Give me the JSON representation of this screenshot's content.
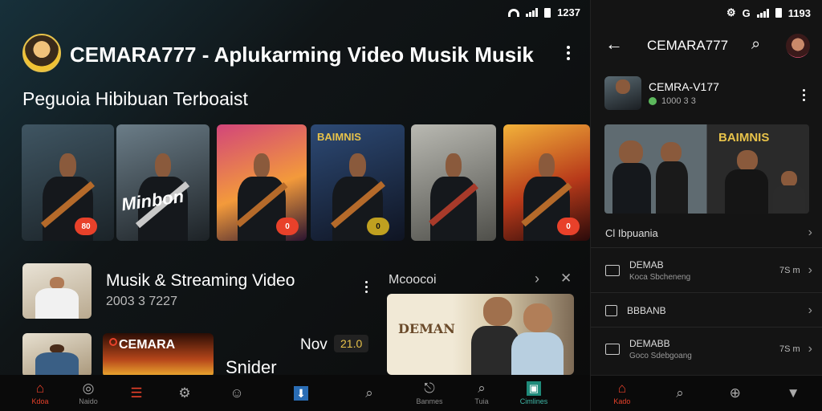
{
  "left_status": {
    "time": "1237"
  },
  "right_status": {
    "time": "1193"
  },
  "channel": {
    "title": "CEMARA777 - Aplukarming Video Musik Musik"
  },
  "section": {
    "title": "Peguoia Hibibuan Terboaist"
  },
  "thumbnails": [
    {
      "badge": "80",
      "badge_color": "#e8412a"
    },
    {
      "badge": "",
      "text": "Minbon"
    },
    {
      "badge": "0",
      "badge_color": "#e8412a"
    },
    {
      "badge": "0",
      "badge_color": "#c0a020",
      "text": "BAIMNIS"
    },
    {
      "badge": ""
    },
    {
      "badge": "0",
      "badge_color": "#e8412a"
    }
  ],
  "video_item": {
    "title": "Musik & Streaming Video",
    "subtitle": "2003 3 7227"
  },
  "video_item2": {
    "banner": "CEMARA",
    "title": "Snider",
    "tag1": "Nov",
    "tag2": "21.0"
  },
  "suggest_panel": {
    "title": "Mcoocoi",
    "poster": "DEMAN"
  },
  "left_nav": [
    {
      "icon": "home-icon",
      "label": "Kdoa",
      "active": true
    },
    {
      "icon": "explore-icon",
      "label": "Naido"
    },
    {
      "icon": "menu-icon",
      "label": ""
    },
    {
      "icon": "settings-icon",
      "label": ""
    },
    {
      "icon": "profile-icon",
      "label": ""
    },
    {
      "icon": "download-icon",
      "label": ""
    },
    {
      "icon": "search-icon",
      "label": ""
    },
    {
      "icon": "share-icon",
      "label": "Banmes"
    },
    {
      "icon": "search-icon",
      "label": "Tuia"
    },
    {
      "icon": "library-icon",
      "label": "Cimlines"
    }
  ],
  "right_header": {
    "title": "CEMARA777"
  },
  "right_channel": {
    "name": "CEMRA-V177",
    "sub": "1000 3 3"
  },
  "right_banner": {
    "text": "BAIMNIS"
  },
  "right_list": [
    {
      "label": "Cl Ibpuania",
      "sub": "",
      "meta": ""
    },
    {
      "label": "DEMAB",
      "sub": "Koca Sbcheneng",
      "meta": "7S m"
    },
    {
      "label": "BBBANB",
      "sub": "",
      "meta": ""
    },
    {
      "label": "DEMABB",
      "sub": "Goco Sdebgoang",
      "meta": "7S m"
    }
  ],
  "right_nav": [
    {
      "icon": "home-icon",
      "label": "Kado",
      "active": true
    },
    {
      "icon": "search-icon",
      "label": ""
    },
    {
      "icon": "zoom-icon",
      "label": ""
    },
    {
      "icon": "library-icon",
      "label": ""
    }
  ],
  "colors": {
    "accent": "#e8412a",
    "gold": "#e7c24a"
  }
}
